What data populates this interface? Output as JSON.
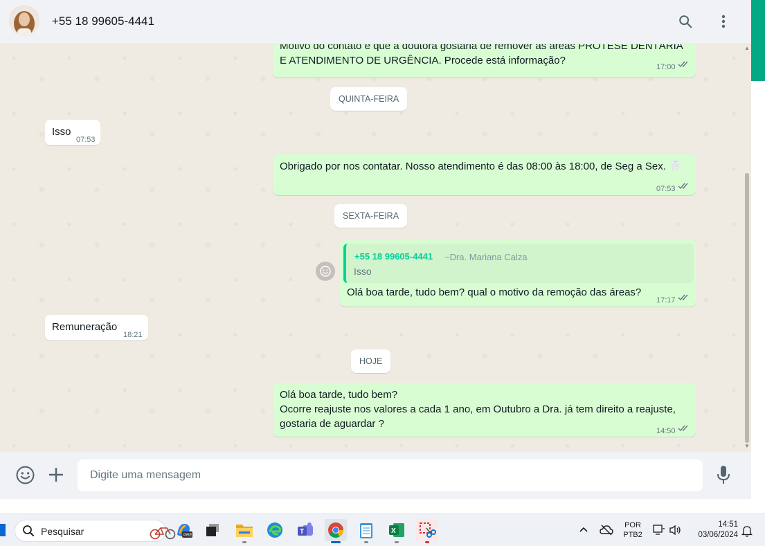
{
  "header": {
    "contact_name": "+55 18 99605-4441",
    "search_icon": "search-icon",
    "menu_icon": "more-vertical-icon"
  },
  "messages": [
    {
      "type": "out",
      "text_line1": "Motivo do contato é que a doutora gostaria de remover as áreas PRÓTESE DENTÁRIA",
      "text_line2": "E ATENDIMENTO DE URGÊNCIA. Procede está informação?",
      "time": "17:00"
    },
    {
      "type": "date",
      "label": "QUINTA-FEIRA"
    },
    {
      "type": "in",
      "text": "Isso",
      "time": "07:53"
    },
    {
      "type": "out",
      "text": "Obrigado por nos contatar. Nosso atendimento é das 08:00 às 18:00, de Seg a Sex. 🦷",
      "time": "07:53"
    },
    {
      "type": "date",
      "label": "SEXTA-FEIRA"
    },
    {
      "type": "out",
      "quote_name": "+55 18 99605-4441",
      "quote_sub": "~Dra. Mariana Calza",
      "quote_text": "Isso",
      "text": "Olá boa tarde, tudo bem? qual o motivo da remoção das áreas?",
      "time": "17:17"
    },
    {
      "type": "in",
      "text": "Remuneração",
      "time": "18:21"
    },
    {
      "type": "date",
      "label": "HOJE"
    },
    {
      "type": "out",
      "text_line1": "Olá boa tarde, tudo bem?",
      "text_line2": "Ocorre reajuste nos valores a cada 1 ano, em Outubro a Dra. já tem direito a reajuste,",
      "text_line3": "gostaria de aguardar ?",
      "time": "14:50"
    }
  ],
  "composer": {
    "placeholder": "Digite uma mensagem",
    "emoji_icon": "emoji-icon",
    "attach_icon": "plus-icon",
    "mic_icon": "microphone-icon"
  },
  "taskbar": {
    "search_placeholder": "Pesquisar",
    "apps": [
      "copilot-icon",
      "task-view-icon",
      "file-explorer-icon",
      "edge-icon",
      "teams-icon",
      "chrome-icon",
      "notepad-icon",
      "excel-icon",
      "snipping-tool-icon"
    ],
    "lang_top": "POR",
    "lang_bottom": "PTB2",
    "time": "14:51",
    "date": "03/06/2024"
  },
  "colors": {
    "outgoing": "#d9fdd3",
    "incoming": "#ffffff",
    "chat_bg": "#efeae2",
    "accent": "#00a884",
    "read_ticks": "#667781"
  }
}
